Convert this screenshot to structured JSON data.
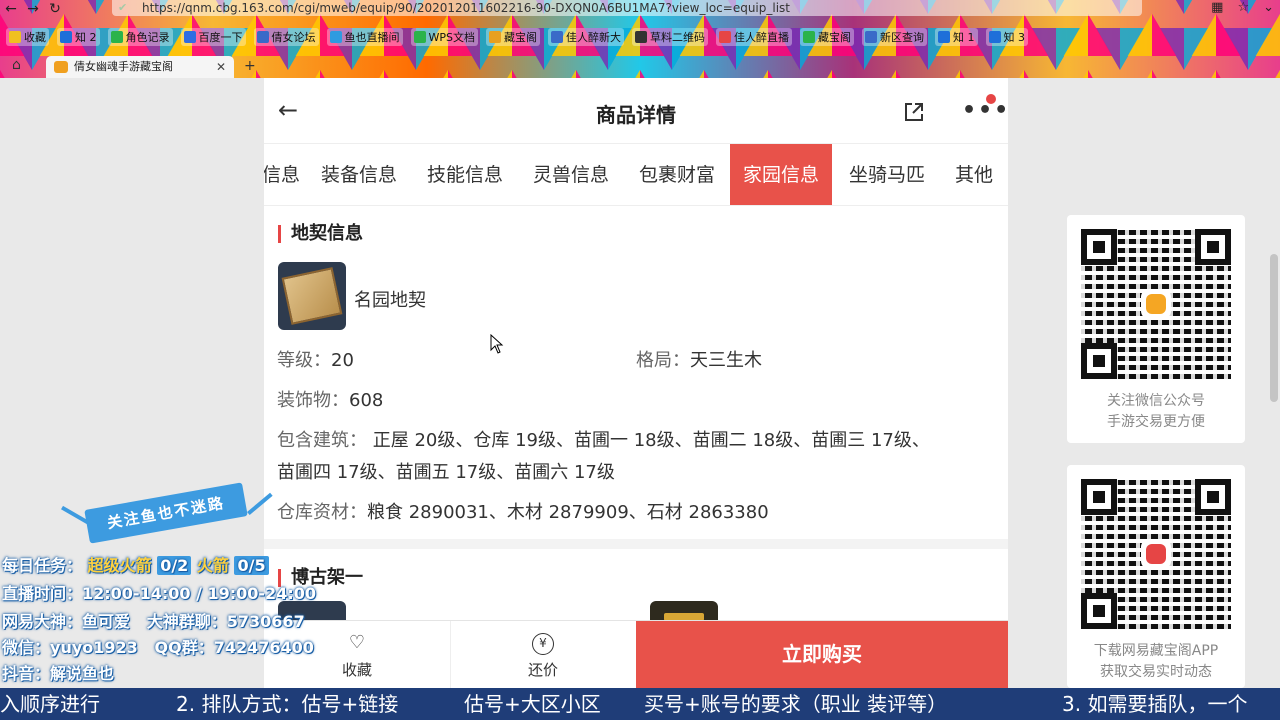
{
  "browser": {
    "url": "https://qnm.cbg.163.com/cgi/mweb/equip/90/202012011602216-90-DXQN0A6BU1MA7?view_loc=equip_list",
    "bookmarks": [
      "收藏",
      "知 2",
      "角色记录",
      "百度一下",
      "倩女论坛",
      "鱼也直播间",
      "WPS文档",
      "藏宝阁",
      "佳人醉新大",
      "草料二维码",
      "佳人醉直播",
      "藏宝阁",
      "新区查询",
      "知 1",
      "知 3"
    ],
    "tab_title": "倩女幽魂手游藏宝阁"
  },
  "header": {
    "title": "商品详情"
  },
  "tabs": [
    {
      "label": "信息"
    },
    {
      "label": "装备信息"
    },
    {
      "label": "技能信息"
    },
    {
      "label": "灵兽信息"
    },
    {
      "label": "包裹财富"
    },
    {
      "label": "家园信息",
      "active": true
    },
    {
      "label": "坐骑马匹"
    },
    {
      "label": "其他"
    }
  ],
  "deed": {
    "section_title": "地契信息",
    "item_name": "名园地契",
    "level_label": "等级：",
    "level_value": "20",
    "layout_label": "格局：",
    "layout_value": "天三生木",
    "decor_label": "装饰物：",
    "decor_value": "608",
    "buildings_label": "包含建筑：",
    "buildings_line1": "正屋 20级、仓库 19级、苗圃一 18级、苗圃二 18级、苗圃三 17级、",
    "buildings_line2": "苗圃四 17级、苗圃五 17级、苗圃六 17级",
    "warehouse_label": "仓库资材：",
    "warehouse_value": "粮食 2890031、木材 2879909、石材 2863380"
  },
  "shelf": {
    "section_title": "博古架一"
  },
  "bottom_bar": {
    "favorite_label": "收藏",
    "bargain_label": "还价",
    "bargain_icon": "¥",
    "buy_label": "立即购买"
  },
  "qr_cards": [
    {
      "caption_line1": "关注微信公众号",
      "caption_line2": "手游交易更方便"
    },
    {
      "caption_line1": "下载网易藏宝阁APP",
      "caption_line2": "获取交易实时动态"
    }
  ],
  "overlay": {
    "banner": "关注鱼也不迷路",
    "task_label": "每日任务：",
    "rocket_super": "超级火箭",
    "rocket_super_count": "0/2",
    "rocket": "火箭",
    "rocket_count": "0/5",
    "stream_time": "直播时间：12:00-14:00 / 19:00-24:00",
    "god_label": "网易大神：",
    "god_value": "鱼可爱",
    "group_label": "大神群聊：",
    "group_value": "5730667",
    "wechat_label": "微信：",
    "wechat_value": "yuyo1923",
    "qq_label": "QQ群：",
    "qq_value": "742476400",
    "douyin_label": "抖音：",
    "douyin_value": "解说鱼也"
  },
  "ticker": {
    "part1": "入顺序进行",
    "part2": "2. 排队方式：估号+链接",
    "part3": "估号+大区小区",
    "part4": "买号+账号的要求（职业  装评等）",
    "part5": "3. 如需要插队，一个"
  },
  "colors": {
    "accent": "#e8524a",
    "ticker_bg": "#1f3d78",
    "overlay_blue": "#3d9be0",
    "overlay_yellow": "#ffd23f"
  }
}
